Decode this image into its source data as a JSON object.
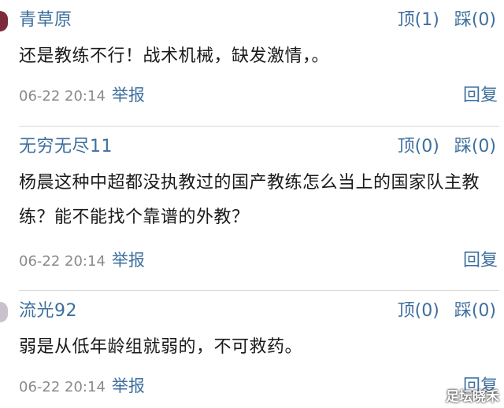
{
  "comments": [
    {
      "username": "青草原",
      "up_label": "顶(1)",
      "down_label": "踩(0)",
      "content": "还是教练不行！战术机械，缺发激情，。",
      "timestamp": "06-22 20:14",
      "report_label": "举报",
      "reply_label": "回复"
    },
    {
      "username": "无穷无尽11",
      "up_label": "顶(0)",
      "down_label": "踩(0)",
      "content": "杨晨这种中超都没执教过的国产教练怎么当上的国家队主教练？能不能找个靠谱的外教？",
      "timestamp": "06-22 20:14",
      "report_label": "举报",
      "reply_label": "回复"
    },
    {
      "username": "流光92",
      "up_label": "顶(0)",
      "down_label": "踩(0)",
      "content": "弱是从低年龄组就弱的，不可救药。",
      "timestamp": "06-22 20:14",
      "report_label": "举报",
      "reply_label": "回复"
    }
  ],
  "watermark": "足坛晓禾",
  "colors": {
    "link": "#3e6f9e",
    "meta": "#8a8a8a",
    "text": "#1a1a1a",
    "divider": "#d9d9d9"
  }
}
